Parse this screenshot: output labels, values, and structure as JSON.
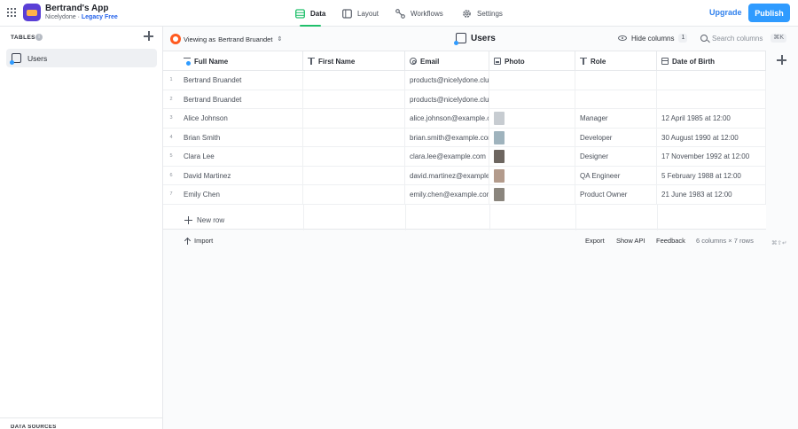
{
  "app": {
    "name": "Bertrand's App",
    "workspace": "Nicelydone",
    "separator": "·",
    "plan": "Legacy Free"
  },
  "nav": {
    "tabs": [
      {
        "label": "Data",
        "icon": "database-icon",
        "active": true
      },
      {
        "label": "Layout",
        "icon": "layout-icon",
        "active": false
      },
      {
        "label": "Workflows",
        "icon": "workflow-icon",
        "active": false
      },
      {
        "label": "Settings",
        "icon": "gear-icon",
        "active": false
      }
    ]
  },
  "header": {
    "upgrade_label": "Upgrade",
    "publish_label": "Publish"
  },
  "sidebar": {
    "tables_title": "TABLES",
    "info_glyph": "i",
    "items": [
      {
        "label": "Users",
        "icon": "users-table-icon",
        "selected": true
      }
    ],
    "bottom_label": "DATA SOURCES"
  },
  "toolbar": {
    "viewing_prefix": "Viewing as",
    "viewing_user": "Bertrand Bruandet",
    "updown_glyph": "⇕",
    "table_title": "Users",
    "hide_columns_label": "Hide columns",
    "hide_columns_count": "1",
    "search_placeholder": "Search columns",
    "search_shortcut": "⌘K"
  },
  "columns": [
    {
      "label": "Full Name",
      "type": "primary-text"
    },
    {
      "label": "First Name",
      "type": "text"
    },
    {
      "label": "Email",
      "type": "email"
    },
    {
      "label": "Photo",
      "type": "image"
    },
    {
      "label": "Role",
      "type": "text"
    },
    {
      "label": "Date of Birth",
      "type": "date"
    }
  ],
  "rows": [
    {
      "num": "1",
      "full_name": "Bertrand Bruandet",
      "first_name": "",
      "email": "products@nicelydone.club",
      "photo": "",
      "role": "",
      "dob": ""
    },
    {
      "num": "2",
      "full_name": "Bertrand Bruandet",
      "first_name": "",
      "email": "products@nicelydone.club",
      "photo": "",
      "role": "",
      "dob": ""
    },
    {
      "num": "3",
      "full_name": "Alice Johnson",
      "first_name": "",
      "email": "alice.johnson@example.com",
      "photo": "#c7ccd1",
      "role": "Manager",
      "dob": "12 April 1985 at 12:00"
    },
    {
      "num": "4",
      "full_name": "Brian Smith",
      "first_name": "",
      "email": "brian.smith@example.com",
      "photo": "#9fb3bd",
      "role": "Developer",
      "dob": "30 August 1990 at 12:00"
    },
    {
      "num": "5",
      "full_name": "Clara Lee",
      "first_name": "",
      "email": "clara.lee@example.com",
      "photo": "#6d6660",
      "role": "Designer",
      "dob": "17 November 1992 at 12:00"
    },
    {
      "num": "6",
      "full_name": "David Martinez",
      "first_name": "",
      "email": "david.martinez@example.com",
      "photo": "#b39b8c",
      "role": "QA Engineer",
      "dob": "5 February 1988 at 12:00"
    },
    {
      "num": "7",
      "full_name": "Emily Chen",
      "first_name": "",
      "email": "emily.chen@example.com",
      "photo": "#8a857d",
      "role": "Product Owner",
      "dob": "21 June 1983 at 12:00"
    }
  ],
  "grid": {
    "new_row_label": "New row",
    "shortcut_hint": "⌘⇧↵"
  },
  "footer": {
    "import_label": "Import",
    "export_label": "Export",
    "show_api_label": "Show API",
    "feedback_label": "Feedback",
    "summary": "6 columns × 7 rows"
  },
  "colors": {
    "accent": "#2f9bff",
    "active_tab_underline": "#20c06b",
    "upgrade": "#2f80ed",
    "app_icon": "#5a3fd6"
  }
}
